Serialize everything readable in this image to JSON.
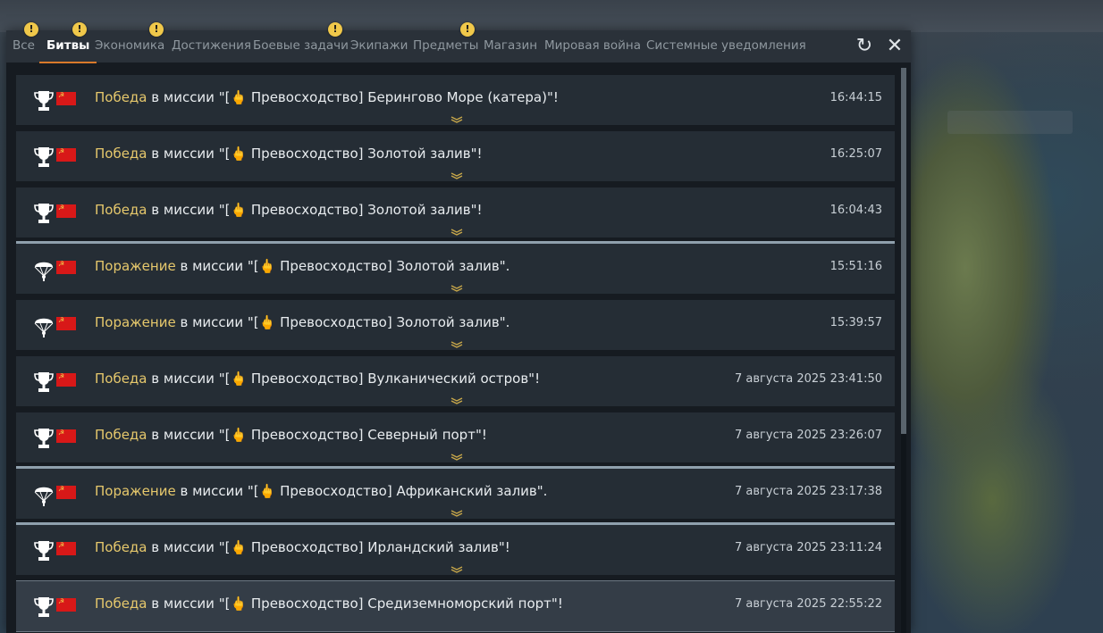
{
  "tabs": [
    {
      "label": "Все",
      "alert": true
    },
    {
      "label": "Битвы",
      "active": true,
      "alert": true
    },
    {
      "label": "Экономика",
      "alert": true
    },
    {
      "label": "Достижения"
    },
    {
      "label": "Боевые задачи",
      "alert": true
    },
    {
      "label": "Экипажи"
    },
    {
      "label": "Предметы",
      "alert": true
    },
    {
      "label": "Магазин"
    },
    {
      "label": "Мировая война"
    },
    {
      "label": "Системные уведомления"
    }
  ],
  "alert_glyph": "!",
  "header": {
    "refresh_icon": "↻",
    "close_icon": "✕"
  },
  "accent_color": "#d9792a",
  "result_color": "#e6c86c",
  "messages": [
    {
      "result": "Победа",
      "icon": "trophy-icon",
      "text": " в миссии \"[🖕 Превосходство] Берингово Море (катера)\"!",
      "time": "16:44:15"
    },
    {
      "result": "Победа",
      "icon": "trophy-icon",
      "text": " в миссии \"[🖕 Превосходство] Золотой залив\"!",
      "time": "16:25:07"
    },
    {
      "result": "Победа",
      "icon": "trophy-icon",
      "text": " в миссии \"[🖕 Превосходство] Золотой залив\"!",
      "time": "16:04:43"
    },
    {
      "result": "Поражение",
      "icon": "parachute-icon",
      "text": " в миссии \"[🖕 Превосходство] Золотой залив\".",
      "time": "15:51:16"
    },
    {
      "result": "Поражение",
      "icon": "parachute-icon",
      "text": " в миссии \"[🖕 Превосходство] Золотой залив\".",
      "time": "15:39:57"
    },
    {
      "result": "Победа",
      "icon": "trophy-icon",
      "text": " в миссии \"[🖕 Превосходство] Вулканический остров\"!",
      "time": "7 августа 2025 23:41:50"
    },
    {
      "result": "Победа",
      "icon": "trophy-icon",
      "text": " в миссии \"[🖕 Превосходство] Северный порт\"!",
      "time": "7 августа 2025 23:26:07"
    },
    {
      "result": "Поражение",
      "icon": "parachute-icon",
      "text": " в миссии \"[🖕 Превосходство] Африканский залив\".",
      "time": "7 августа 2025 23:17:38"
    },
    {
      "result": "Победа",
      "icon": "trophy-icon",
      "text": " в миссии \"[🖕 Превосходство] Ирландский залив\"!",
      "time": "7 августа 2025 23:11:24"
    },
    {
      "result": "Победа",
      "icon": "trophy-icon",
      "text": " в миссии \"[🖕 Превосходство] Средиземноморский порт\"!",
      "time": "7 августа 2025 22:55:22"
    }
  ]
}
